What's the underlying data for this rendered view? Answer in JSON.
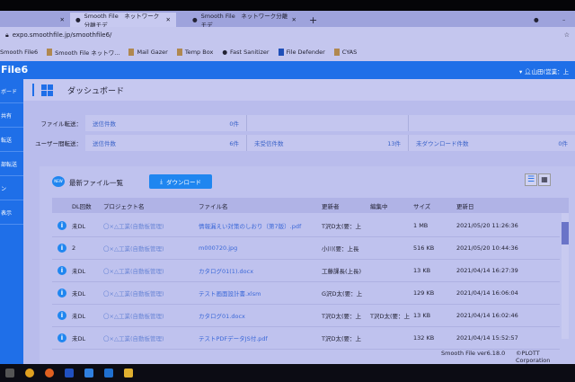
{
  "browser": {
    "tabs": [
      {
        "label": "Smooth File　ネットワーク分離モデ"
      },
      {
        "label": "Smooth File　ネットワーク分離モデ"
      }
    ],
    "url": "expo.smoothfile.jp/smoothfile6/",
    "bookmarks": [
      "Smooth File6",
      "Smooth File ネットワ...",
      "Mail Gazer",
      "Temp Box",
      "Fast Sanitizer",
      "File Defender",
      "CYAS"
    ]
  },
  "app": {
    "logo": "File6",
    "user": "山田(営業：上",
    "sidebar": [
      "ボード",
      "共有",
      "転送",
      "部転送",
      "ン",
      "表示"
    ],
    "page_title": "ダッシュボード"
  },
  "summary": {
    "file_label": "ファイル転送：",
    "user_label": "ユーザー間転送：",
    "file_cells": [
      {
        "label": "送信件数",
        "value": "0件"
      }
    ],
    "user_cells": [
      {
        "label": "送信件数",
        "value": "6件"
      },
      {
        "label": "未受信件数",
        "value": "13件"
      },
      {
        "label": "未ダウンロード件数",
        "value": "0件"
      }
    ]
  },
  "list": {
    "badge": "NEW",
    "title": "最新ファイル一覧",
    "download_label": "ダウンロード",
    "columns": [
      "DL回数",
      "プロジェクト名",
      "ファイル名",
      "更新者",
      "編集中",
      "サイズ",
      "更新日"
    ],
    "rows": [
      {
        "dl": "未DL",
        "project": "〇×△工業(自動板管理)",
        "file": "情報漏えい対策のしおり（第7版）.pdf",
        "updater": "T沢D太(要：上",
        "editing": "",
        "size": "1 MB",
        "date": "2021/05/20 11:26:36"
      },
      {
        "dl": "2",
        "project": "〇×△工業(自動板管理)",
        "file": "m000720.jpg",
        "updater": "小川(要：上長",
        "editing": "",
        "size": "516 KB",
        "date": "2021/05/20 10:44:36"
      },
      {
        "dl": "未DL",
        "project": "〇×△工業(自動板管理)",
        "file": "カタログ01(1).docx",
        "updater": "工藤課長(上長)",
        "editing": "",
        "size": "13 KB",
        "date": "2021/04/14 16:27:39"
      },
      {
        "dl": "未DL",
        "project": "〇×△工業(自動板管理)",
        "file": "テスト画面設計書.xlsm",
        "updater": "G沢D太(要：上",
        "editing": "",
        "size": "129 KB",
        "date": "2021/04/14 16:06:04"
      },
      {
        "dl": "未DL",
        "project": "〇×△工業(自動板管理)",
        "file": "カタログ01.docx",
        "updater": "T沢D太(要：上",
        "editing": "T沢D太(要：上",
        "size": "13 KB",
        "date": "2021/04/14 16:02:46"
      },
      {
        "dl": "未DL",
        "project": "〇×△工業(自動板管理)",
        "file": "テストPDFデータJS付.pdf",
        "updater": "T沢D太(要：上",
        "editing": "",
        "size": "132 KB",
        "date": "2021/04/14 15:52:57"
      }
    ]
  },
  "footer": {
    "version": "Smooth File ver6.18.0",
    "copyright": "©PLOTT Corporation"
  },
  "colors": {
    "accent": "#1f6fe8",
    "button": "#1f86f0"
  }
}
